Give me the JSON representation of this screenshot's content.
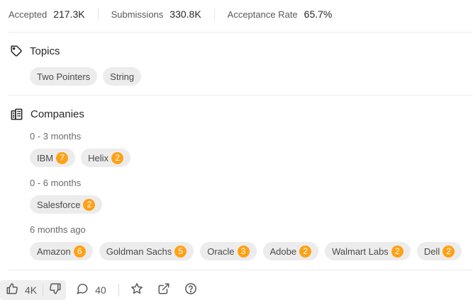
{
  "stats": {
    "accepted_label": "Accepted",
    "accepted_value": "217.3K",
    "submissions_label": "Submissions",
    "submissions_value": "330.8K",
    "acceptance_rate_label": "Acceptance Rate",
    "acceptance_rate_value": "65.7%"
  },
  "topics": {
    "title": "Topics",
    "icon": "tag-icon",
    "tags": [
      "Two Pointers",
      "String"
    ]
  },
  "companies": {
    "title": "Companies",
    "icon": "building-icon",
    "groups": [
      {
        "period": "0 - 3 months",
        "items": [
          {
            "name": "IBM",
            "count": "7"
          },
          {
            "name": "Helix",
            "count": "2"
          }
        ]
      },
      {
        "period": "0 - 6 months",
        "items": [
          {
            "name": "Salesforce",
            "count": "2"
          }
        ]
      },
      {
        "period": "6 months ago",
        "items": [
          {
            "name": "Amazon",
            "count": "6"
          },
          {
            "name": "Goldman Sachs",
            "count": "5"
          },
          {
            "name": "Oracle",
            "count": "3"
          },
          {
            "name": "Adobe",
            "count": "2"
          },
          {
            "name": "Walmart Labs",
            "count": "2"
          },
          {
            "name": "Dell",
            "count": "2"
          }
        ]
      }
    ],
    "badge_color": "#ffa116"
  },
  "actions": {
    "likes": "4K",
    "comments": "40",
    "icons": [
      "thumbs-up-icon",
      "thumbs-down-icon",
      "comment-icon",
      "star-icon",
      "share-icon",
      "help-icon"
    ]
  }
}
